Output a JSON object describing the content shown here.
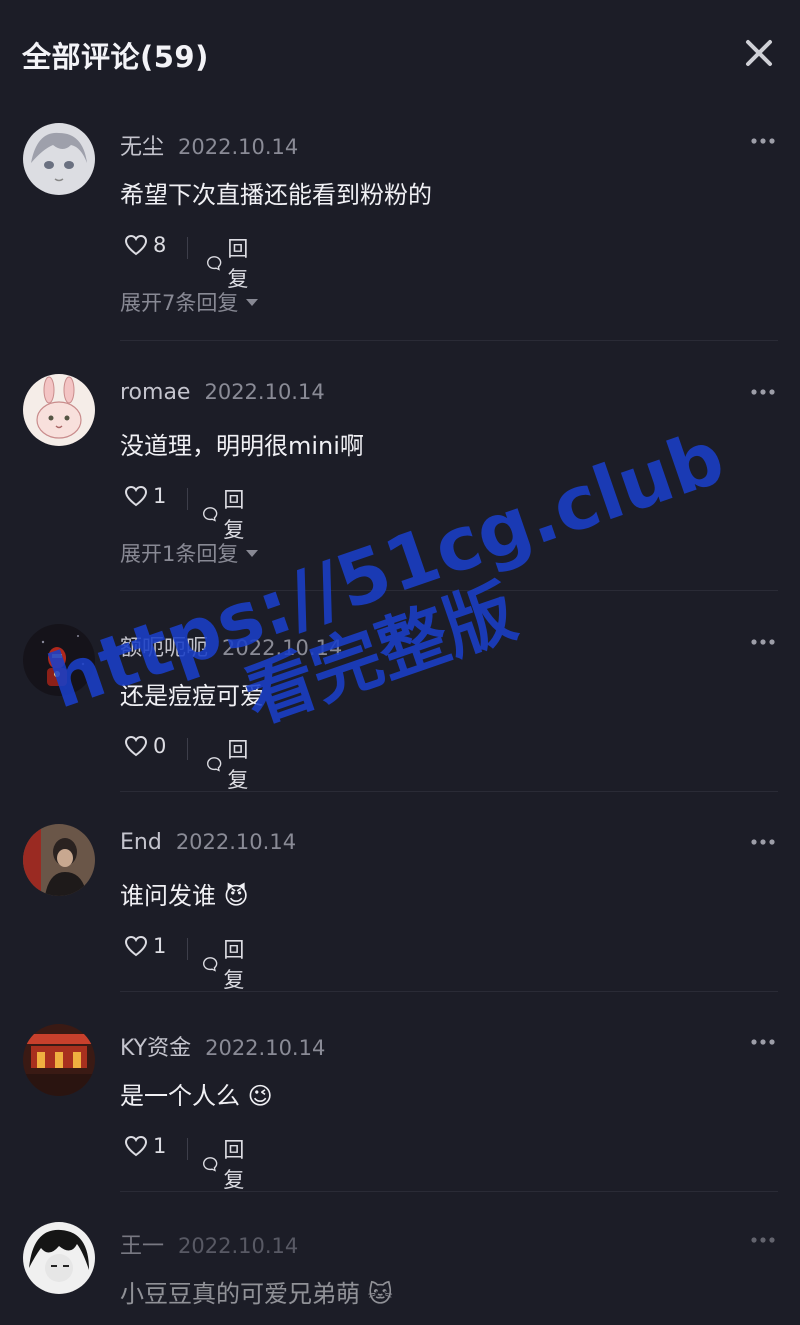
{
  "header": {
    "title": "全部评论(59)",
    "close_icon": "close-icon"
  },
  "comments": [
    {
      "user": "无尘",
      "time": "2022.10.14",
      "text": "希望下次直播还能看到粉粉的",
      "likes": "8",
      "reply_label": "回复",
      "expand": "展开7条回复",
      "avatar_color": "#d8d8dc"
    },
    {
      "user": "romae",
      "time": "2022.10.14",
      "text": "没道理，明明很mini啊",
      "likes": "1",
      "reply_label": "回复",
      "expand": "展开1条回复",
      "avatar_color": "#f2e6de"
    },
    {
      "user": "额呃呃呃",
      "time": "2022.10.14",
      "text": "还是痘痘可爱",
      "likes": "0",
      "reply_label": "回复",
      "avatar_color": "#2a1a18"
    },
    {
      "user": "End",
      "time": "2022.10.14",
      "text": "谁问发谁 😈",
      "likes": "1",
      "reply_label": "回复",
      "avatar_color": "#5a4a40"
    },
    {
      "user": "KY资金",
      "time": "2022.10.14",
      "text": "是一个人么 😉",
      "likes": "1",
      "reply_label": "回复",
      "avatar_color": "#b04030"
    },
    {
      "user": "王一",
      "time": "2022.10.14",
      "text": "小豆豆真的可爱兄弟萌 🐱",
      "avatar_color": "#e8e8e8"
    }
  ],
  "watermark": {
    "line1": "https://51cg.club",
    "line2": "看完整版"
  }
}
